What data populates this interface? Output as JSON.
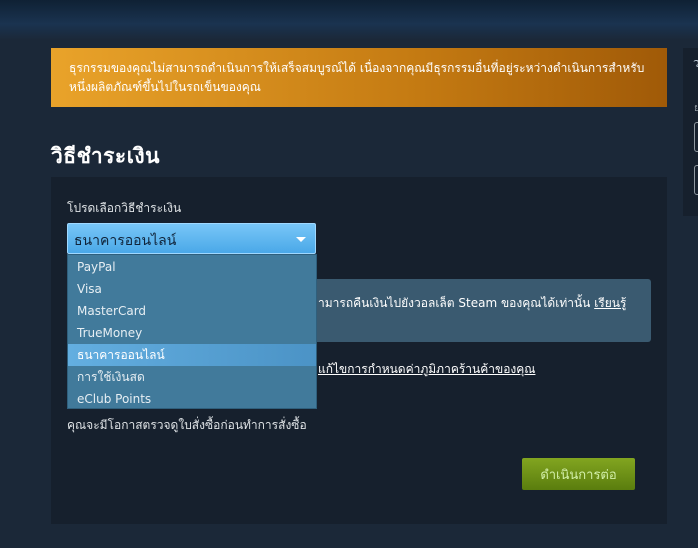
{
  "alert": {
    "line1": "ธุรกรรมของคุณไม่สามารถดำเนินการให้เสร็จสมบูรณ์ได้ เนื่องจากคุณมีธุรกรรมอื่นที่อยู่ระหว่างดำเนินการสำหรับ",
    "line2": "หนึ่งผลิตภัณฑ์ขึ้นไปในรถเข็นของคุณ"
  },
  "page_title": "วิธีชำระเงิน",
  "payment": {
    "select_label": "โปรดเลือกวิธีชำระเงิน",
    "selected_value": "ธนาคารออนไลน์",
    "options": [
      "PayPal",
      "Visa",
      "MasterCard",
      "TrueMoney",
      "ธนาคารออนไลน์",
      "การใช้เงินสด",
      "eClub Points"
    ],
    "selected_index": 4
  },
  "info": {
    "text": "ามารถคืนเงินไปยังวอลเล็ต Steam ของคุณได้เท่านั้น ",
    "link": "เรียนรู้"
  },
  "terms_link": "แก้ไขการกำหนดค่าภูมิภาคร้านค้าของคุณ",
  "review_note": "คุณจะมีโอกาสตรวจดูใบสั่งซื้อก่อนทำการสั่งซื้อ",
  "continue_button": "ดำเนินการต่อ",
  "sidebar": {
    "char": "ว",
    "dot": "ย"
  },
  "colors": {
    "background": "#1b2838",
    "panel": "#16202d",
    "alert_start": "#e9a32a",
    "alert_end": "#a05a08",
    "select_accent": "#4aa8e8",
    "button_green": "#82a520"
  }
}
